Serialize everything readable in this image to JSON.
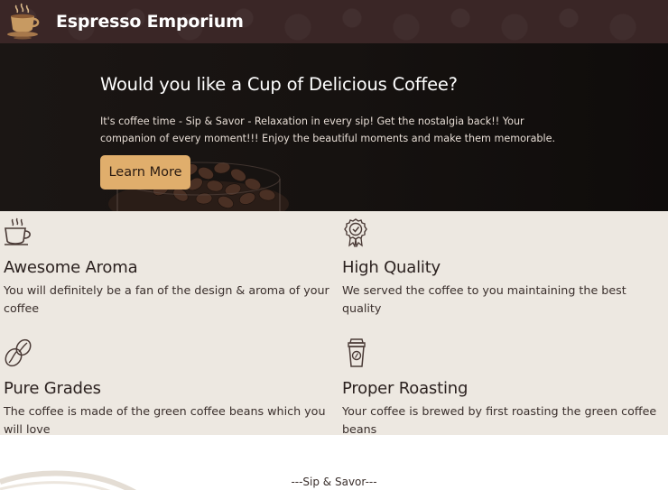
{
  "navbar": {
    "brand": "Espresso Emporium",
    "logo_icon": "coffee-cup-logo-icon"
  },
  "hero": {
    "title": "Would you like a Cup of Delicious Coffee?",
    "description": "It's coffee time - Sip & Savor - Relaxation in every sip! Get the nostalgia back!! Your companion of every moment!!! Enjoy the beautiful moments and make them memorable.",
    "button_label": "Learn More",
    "button_color": "#e0ae6c"
  },
  "features": [
    {
      "icon": "coffee-cup-icon",
      "title": "Awesome Aroma",
      "text": "You will definitely be a fan of the design & aroma of your coffee"
    },
    {
      "icon": "quality-badge-icon",
      "title": "High Quality",
      "text": "We served the coffee to you maintaining the best quality"
    },
    {
      "icon": "coffee-bean-icon",
      "title": "Pure Grades",
      "text": "The coffee is made of the green coffee beans which you will love"
    },
    {
      "icon": "takeaway-cup-icon",
      "title": "Proper Roasting",
      "text": "Your coffee is brewed by first roasting the green coffee beans"
    }
  ],
  "footer": {
    "tagline": "---Sip & Savor---"
  },
  "colors": {
    "navbar_bg": "#3a2626",
    "features_bg": "#ede8e1",
    "accent": "#e0ae6c"
  }
}
